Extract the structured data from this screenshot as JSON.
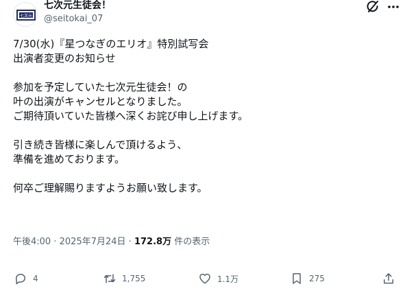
{
  "author": {
    "name": "七次元生徒会！",
    "handle": "@seitokai_07",
    "avatar_text": "七次元"
  },
  "tweet": {
    "lines": [
      "7/30(水)『星つなぎのエリオ』特別試写会",
      "出演者変更のお知らせ",
      "",
      "参加を予定していた七次元生徒会！の",
      "叶の出演がキャンセルとなりました。",
      "ご期待頂いていた皆様へ深くお詫び申し上げます。",
      "",
      "引き続き皆様に楽しんで頂けるよう、",
      "準備を進めております。",
      "",
      "何卒ご理解賜りますようお願い致します。"
    ]
  },
  "meta": {
    "time": "午後4:00",
    "separator": "·",
    "date": "2025年7月24日",
    "views_count": "172.8万",
    "views_label": "件の表示"
  },
  "actions": {
    "replies": "4",
    "reposts": "1,755",
    "likes": "1.1万",
    "bookmarks": "275"
  },
  "icons": {
    "grok": "grok-icon",
    "more": "more-icon",
    "reply": "reply-icon",
    "repost": "repost-icon",
    "like": "like-icon",
    "bookmark": "bookmark-icon",
    "share": "share-icon"
  },
  "colors": {
    "text": "#0f1419",
    "secondary": "#536471",
    "background": "#ffffff"
  }
}
